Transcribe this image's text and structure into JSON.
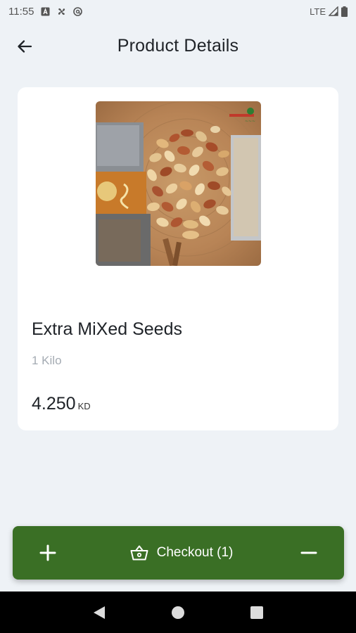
{
  "status_bar": {
    "time": "11:55",
    "network": "LTE",
    "icons": [
      "a-notification-icon",
      "fan-icon",
      "at-icon",
      "signal-icon",
      "battery-icon"
    ]
  },
  "header": {
    "title": "Product Details",
    "back_icon": "arrow-left-icon"
  },
  "product": {
    "name": "Extra MiXed Seeds",
    "size": "1 Kilo",
    "price": "4.250",
    "currency": "KD",
    "image": "mixed-nuts-product-photo"
  },
  "checkout_bar": {
    "label": "Checkout (1)",
    "plus_icon": "plus-icon",
    "minus_icon": "minus-icon",
    "basket_icon": "basket-icon",
    "color": "#3a6f25"
  },
  "nav_bar": {
    "icons": [
      "back-triangle-icon",
      "home-circle-icon",
      "recents-square-icon"
    ]
  },
  "colors": {
    "background": "#eef2f6",
    "card": "#ffffff",
    "muted_text": "#a4abb3"
  }
}
